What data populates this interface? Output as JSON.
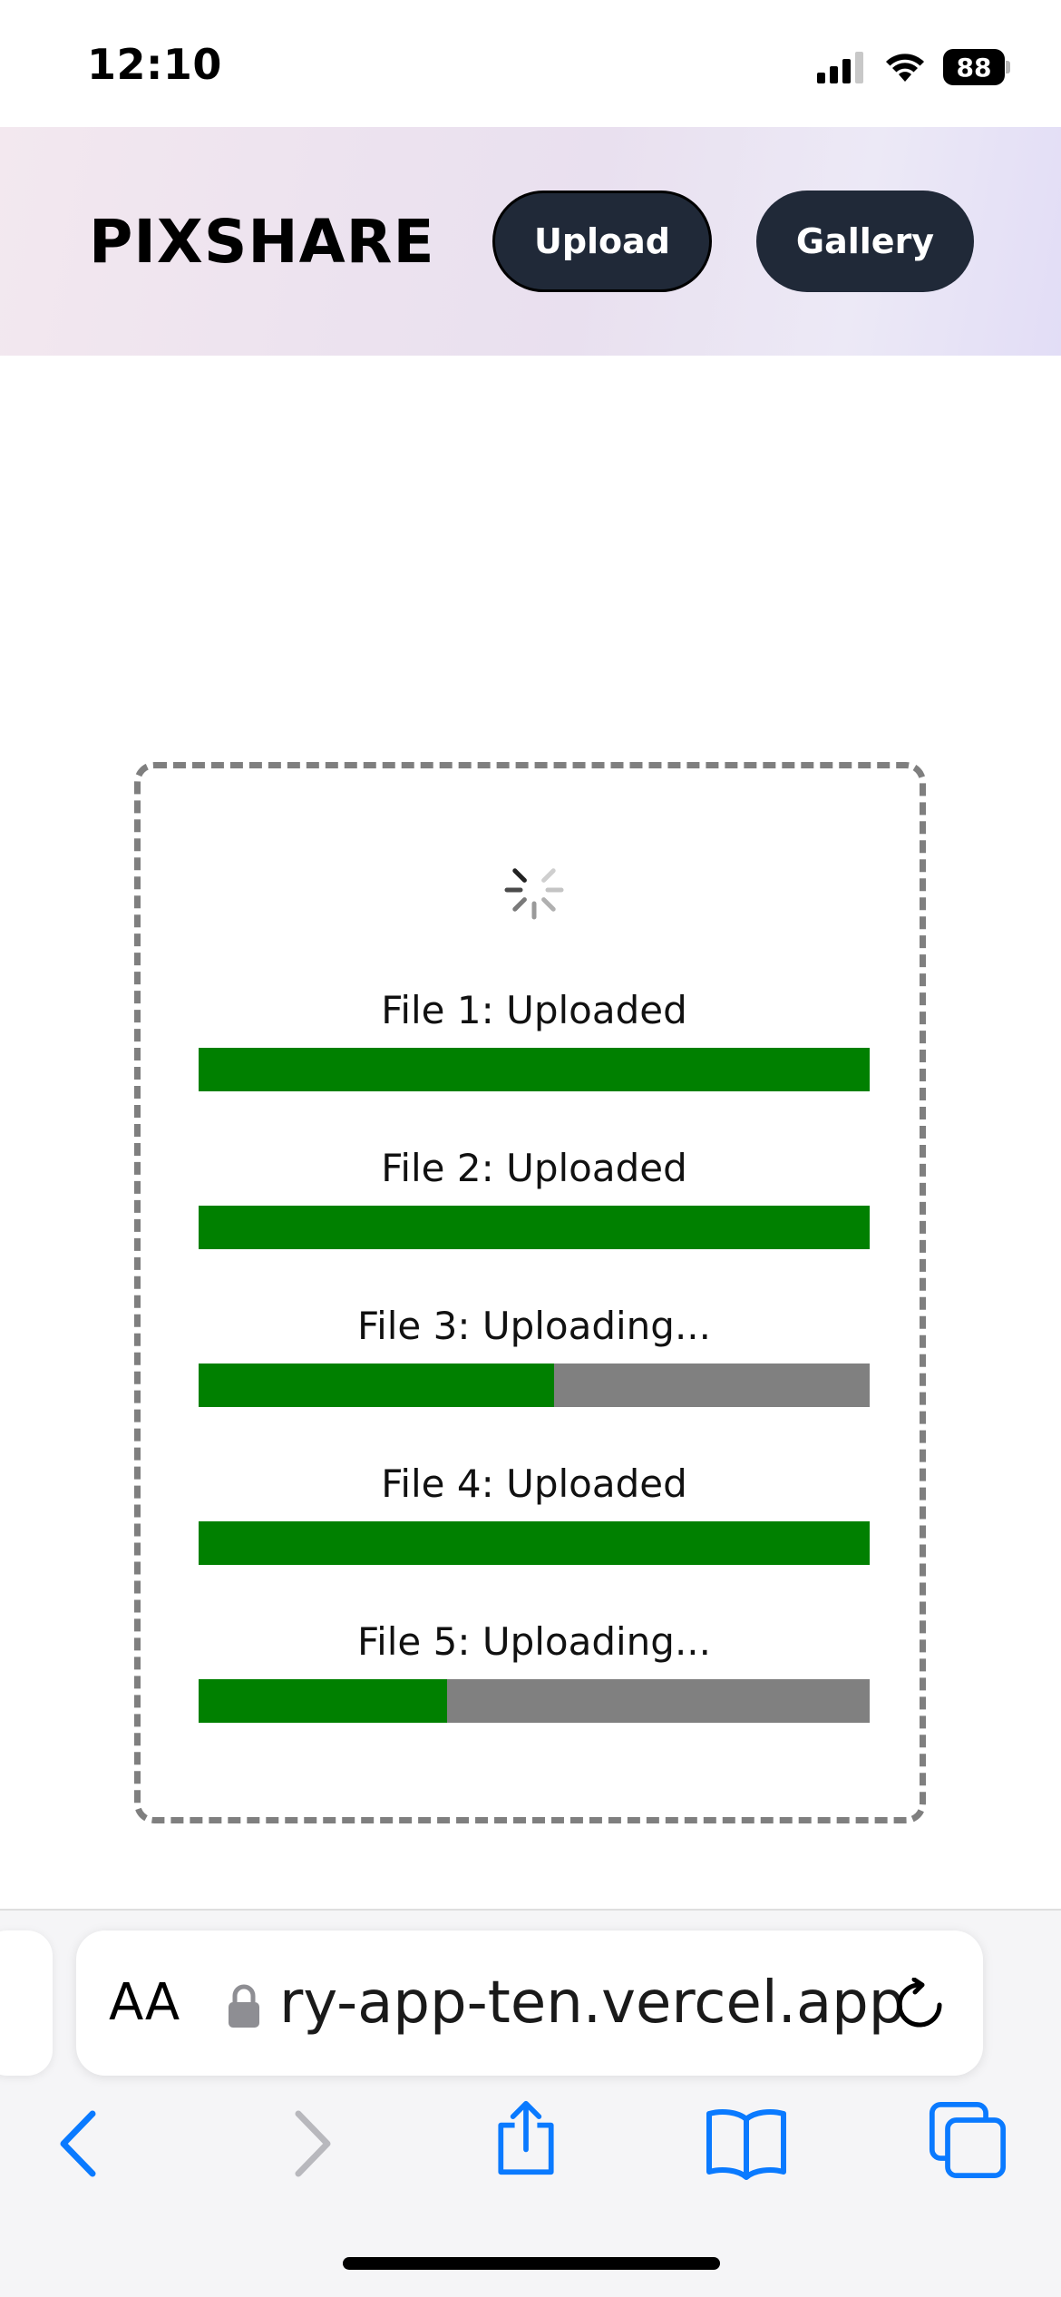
{
  "status_bar": {
    "time": "12:10",
    "battery": "88",
    "icons": [
      "signal-icon",
      "wifi-icon",
      "battery-icon"
    ]
  },
  "header": {
    "brand": "PIXSHARE",
    "nav": [
      {
        "label": "Upload"
      },
      {
        "label": "Gallery"
      }
    ],
    "colors": {
      "button_bg": "#202938",
      "button_text": "#ffffff"
    }
  },
  "upload": {
    "spinner_icon": "loading-spinner-icon",
    "files": [
      {
        "label": "File 1: Uploaded",
        "progress": 1.0
      },
      {
        "label": "File 2: Uploaded",
        "progress": 1.0
      },
      {
        "label": "File 3: Uploading...",
        "progress": 0.53
      },
      {
        "label": "File 4: Uploaded",
        "progress": 1.0
      },
      {
        "label": "File 5: Uploading...",
        "progress": 0.37
      }
    ],
    "colors": {
      "fill": "#008000",
      "track": "#808080",
      "border": "#7f7f7f"
    }
  },
  "browser": {
    "reader_label": "AA",
    "url": "ry-app-ten.vercel.app",
    "icons": [
      "lock-icon",
      "reload-icon",
      "back-icon",
      "forward-icon",
      "share-icon",
      "bookmarks-icon",
      "tabs-icon"
    ],
    "accent": "#0a7aff"
  }
}
